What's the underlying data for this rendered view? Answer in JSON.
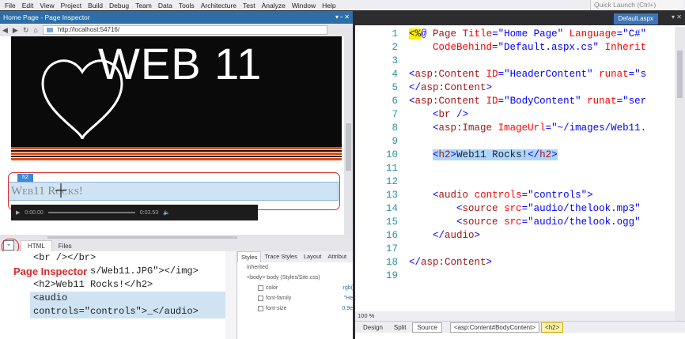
{
  "menu": [
    "File",
    "Edit",
    "View",
    "Project",
    "Build",
    "Debug",
    "Team",
    "Data",
    "Tools",
    "Architecture",
    "Test",
    "Analyze",
    "Window",
    "Help"
  ],
  "quick_launch_placeholder": "Quick Launch (Ctrl+)",
  "inspector": {
    "title": "Home Page - Page Inspector",
    "url": "http://localhost:54716/",
    "logo_text": "WEB 11",
    "h2_tag": "h2",
    "h2_text": "Web11 Rocks!",
    "audio_time_start": "0:00.00",
    "audio_time_end": "0:03.53",
    "tabs": {
      "html": "HTML",
      "files": "Files"
    },
    "label": "Page Inspector",
    "html_lines": [
      "<br /></br>",
      "src=\"images/Web11.JPG\"></img>",
      "<h2>Web11 Rocks!</h2>",
      "<audio",
      "controls=\"controls\">_</audio>"
    ],
    "styles_tabs": [
      "Styles",
      "Trace Styles",
      "Layout",
      "Attribut"
    ],
    "styles_rows": [
      {
        "label": "inherited",
        "value": ""
      },
      {
        "label": "<body> body (Styles/Site.css)",
        "value": ""
      },
      {
        "label": "color",
        "value": "rgb("
      },
      {
        "label": "font-family",
        "value": "\"He"
      },
      {
        "label": "font-size",
        "value": "0.9e"
      }
    ]
  },
  "editor": {
    "tab": "Default.aspx",
    "lines": [
      {
        "n": "1"
      },
      {
        "n": "2"
      },
      {
        "n": "3"
      },
      {
        "n": "4"
      },
      {
        "n": "5"
      },
      {
        "n": "6"
      },
      {
        "n": "7"
      },
      {
        "n": "8"
      },
      {
        "n": "9"
      },
      {
        "n": "10"
      },
      {
        "n": "11"
      },
      {
        "n": "12"
      },
      {
        "n": "13"
      },
      {
        "n": "14"
      },
      {
        "n": "15"
      },
      {
        "n": "16"
      },
      {
        "n": "17"
      },
      {
        "n": "18"
      },
      {
        "n": "19"
      }
    ],
    "zoom": "100 %",
    "view_buttons": [
      "Design",
      "Split",
      "Source"
    ],
    "crumbs": [
      "<asp:Content#BodyContent>",
      "<h2>"
    ]
  }
}
